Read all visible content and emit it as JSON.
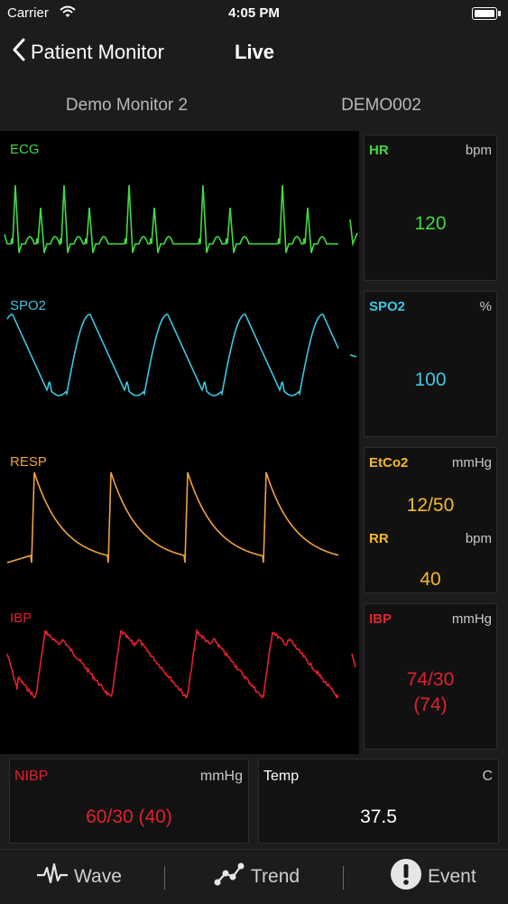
{
  "status_bar": {
    "carrier": "Carrier",
    "time": "4:05 PM"
  },
  "nav": {
    "back_label": "Patient Monitor",
    "title": "Live"
  },
  "device": {
    "name": "Demo Monitor 2",
    "id": "DEMO002"
  },
  "waves": [
    {
      "label": "ECG",
      "color": "#43d943"
    },
    {
      "label": "SPO2",
      "color": "#3fc6e0"
    },
    {
      "label": "RESP",
      "color": "#f0a23c"
    },
    {
      "label": "IBP",
      "color": "#e0222c"
    }
  ],
  "panels": {
    "hr": {
      "label": "HR",
      "unit": "bpm",
      "value": "120",
      "color": "#43d943"
    },
    "spo2": {
      "label": "SPO2",
      "unit": "%",
      "value": "100",
      "color": "#3fc6e0"
    },
    "etco2": {
      "label": "EtCo2",
      "unit": "mmHg",
      "value": "12/50",
      "color": "#f5b82e"
    },
    "rr": {
      "label": "RR",
      "unit": "bpm",
      "value": "40",
      "color": "#f5b82e"
    },
    "ibp": {
      "label": "IBP",
      "unit": "mmHg",
      "value_line1": "74/30",
      "value_line2": "(74)",
      "color": "#e0222c"
    }
  },
  "bottom": {
    "nibp": {
      "label": "NIBP",
      "unit": "mmHg",
      "value": "60/30 (40)",
      "color": "#e0222c"
    },
    "temp": {
      "label": "Temp",
      "unit": "C",
      "value": "37.5"
    }
  },
  "tabs": [
    {
      "label": "Wave",
      "icon": "wave-icon"
    },
    {
      "label": "Trend",
      "icon": "trend-icon"
    },
    {
      "label": "Event",
      "icon": "exclamation-icon"
    }
  ]
}
